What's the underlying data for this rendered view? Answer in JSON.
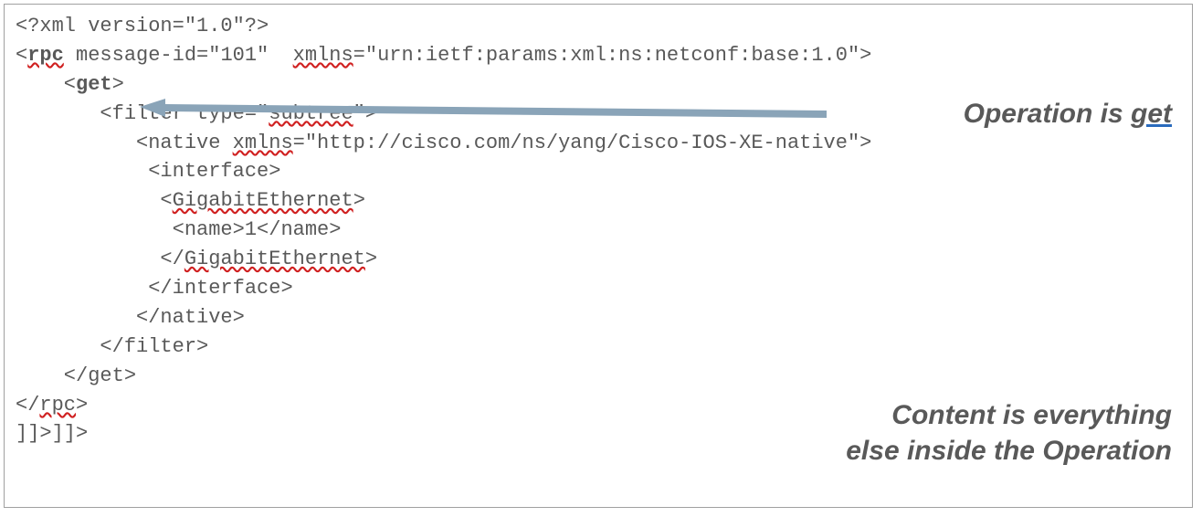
{
  "code": {
    "l1": "<?xml version=\"1.0\"?>",
    "l2a": "<",
    "l2b": "rpc",
    "l2c": " message-id=\"101\"  ",
    "l2d": "xmlns",
    "l2e": "=\"urn:ietf:params:xml:ns:netconf:base:1.0\">",
    "l3a": "    <",
    "l3b": "get",
    "l3c": ">",
    "l4a": "       <filter type=\"",
    "l4b": "subtree",
    "l4c": "\">",
    "l5a": "          <native ",
    "l5b": "xmlns",
    "l5c": "=\"http://cisco.com/ns/yang/Cisco-IOS-XE-native\">",
    "l6": "           <interface>",
    "l7a": "            <",
    "l7b": "GigabitEthernet",
    "l7c": ">",
    "l8": "             <name>1</name>",
    "l9a": "            </",
    "l9b": "GigabitEthernet",
    "l9c": ">",
    "l10": "           </interface>",
    "l11": "          </native>",
    "l12": "       </filter>",
    "l13": "    </get>",
    "l14a": "</",
    "l14b": "rpc",
    "l14c": ">",
    "l15": "]]>]]>"
  },
  "notes": {
    "operation_prefix": "Operation is ",
    "operation_word": "get",
    "content_line1": "Content is everything",
    "content_line2": "else inside the Operation"
  }
}
